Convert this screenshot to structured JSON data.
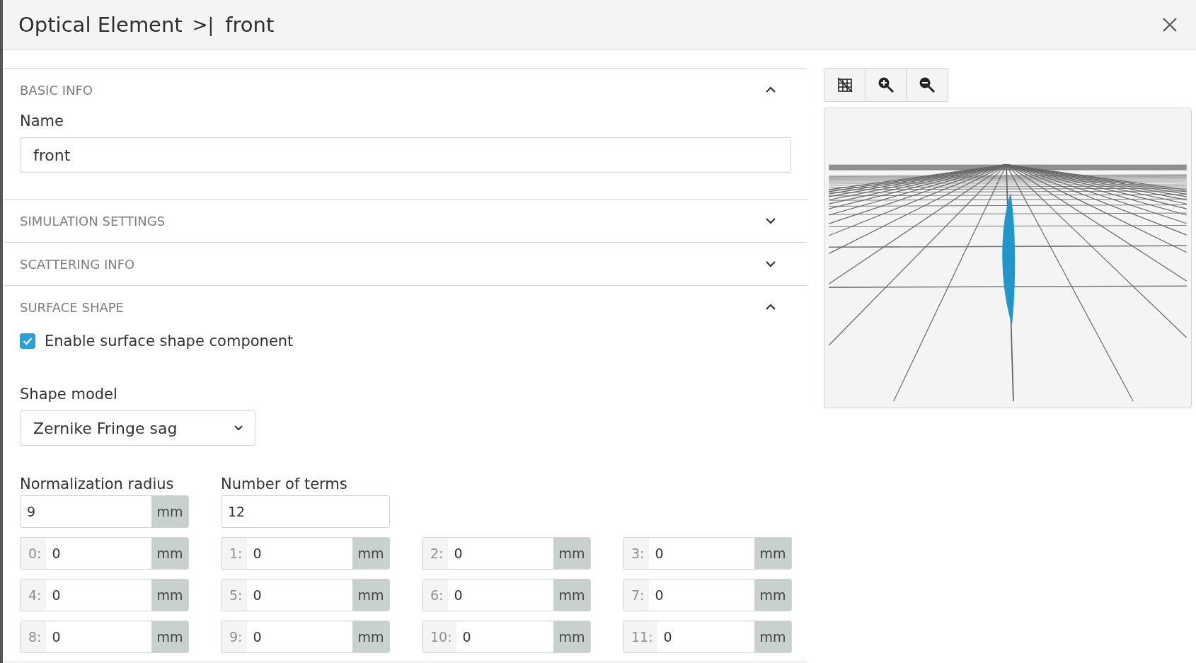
{
  "header": {
    "title": "Optical Element",
    "separator": ">|",
    "current": "front"
  },
  "sections": [
    {
      "kind": "basic",
      "title": "BASIC INFO",
      "expanded": true,
      "name_label": "Name",
      "name_value": "front"
    },
    {
      "kind": "plain",
      "title": "SIMULATION SETTINGS",
      "expanded": false
    },
    {
      "kind": "plain",
      "title": "SCATTERING INFO",
      "expanded": false
    },
    {
      "kind": "surface",
      "title": "SURFACE SHAPE",
      "expanded": true,
      "enable": {
        "label": "Enable surface shape component",
        "checked": true
      },
      "shape_model": {
        "label": "Shape model",
        "value": "Zernike Fringe sag"
      },
      "normalization_radius": {
        "label": "Normalization radius",
        "value": "9",
        "unit": "mm"
      },
      "number_of_terms": {
        "label": "Number of terms",
        "value": "12"
      },
      "coefficients": [
        {
          "index": "0:",
          "value": "0",
          "unit": "mm"
        },
        {
          "index": "1:",
          "value": "0",
          "unit": "mm"
        },
        {
          "index": "2:",
          "value": "0",
          "unit": "mm"
        },
        {
          "index": "3:",
          "value": "0",
          "unit": "mm"
        },
        {
          "index": "4:",
          "value": "0",
          "unit": "mm"
        },
        {
          "index": "5:",
          "value": "0",
          "unit": "mm"
        },
        {
          "index": "6:",
          "value": "0",
          "unit": "mm"
        },
        {
          "index": "7:",
          "value": "0",
          "unit": "mm"
        },
        {
          "index": "8:",
          "value": "0",
          "unit": "mm"
        },
        {
          "index": "9:",
          "value": "0",
          "unit": "mm"
        },
        {
          "index": "10:",
          "value": "0",
          "unit": "mm"
        },
        {
          "index": "11:",
          "value": "0",
          "unit": "mm"
        }
      ]
    }
  ]
}
